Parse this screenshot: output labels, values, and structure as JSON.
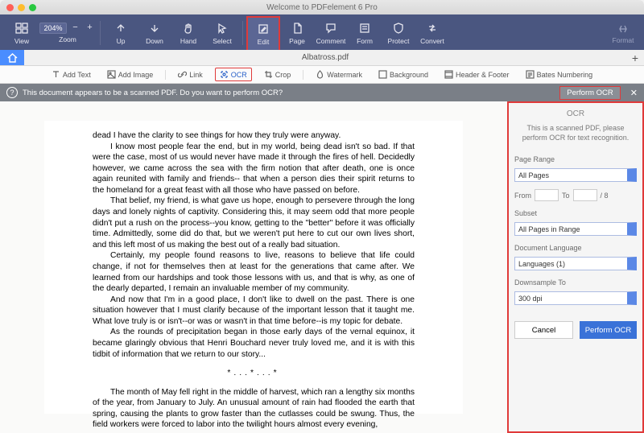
{
  "window": {
    "title": "Welcome to PDFelement 6 Pro"
  },
  "ribbon": {
    "view": "View",
    "zoom": "Zoom",
    "zoom_value": "204%",
    "up": "Up",
    "down": "Down",
    "hand": "Hand",
    "select": "Select",
    "edit": "Edit",
    "page": "Page",
    "comment": "Comment",
    "form": "Form",
    "protect": "Protect",
    "convert": "Convert",
    "format": "Format"
  },
  "tab": {
    "filename": "Albatross.pdf"
  },
  "toolbar2": {
    "add_text": "Add Text",
    "add_image": "Add Image",
    "link": "Link",
    "ocr": "OCR",
    "crop": "Crop",
    "watermark": "Watermark",
    "background": "Background",
    "header_footer": "Header & Footer",
    "bates": "Bates Numbering"
  },
  "notice": {
    "text": "This document appears to be a scanned PDF. Do you want to perform OCR?",
    "button": "Perform OCR"
  },
  "document": {
    "p1": "dead I have the clarity to see things for how they truly were anyway.",
    "p2": "I know most people fear the end, but in my world, being dead isn't so bad. If that were the case, most of us would never have made it through the fires of hell. Decidedly however, we came across the sea with the firm notion that after death, one is once again reunited with family and friends-- that when a person dies their spirit returns to the homeland for a great feast with all those who have passed on before.",
    "p3": "That belief, my friend, is what gave us hope, enough to persevere through the long days and lonely nights of captivity. Considering this, it may seem odd that more people didn't put a rush on the process--you know, getting to the \"better\" before it was officially time. Admittedly, some did do that, but we weren't put here to cut our own lives short, and this left most of us making the best out of a really bad situation.",
    "p4": "Certainly, my people found reasons to live, reasons to believe that life could change, if not for themselves then at least for the generations that came after. We learned from our hardships and took those lessons with us, and that is why, as one of the dearly departed, I remain an invaluable member of my community.",
    "p5": "And now that I'm in a good place, I don't like to dwell on the past. There is one situation however that I must clarify because of the important lesson that it taught me. What love truly is or isn't--or was or wasn't in that time before--is my topic for debate.",
    "p6": "As the rounds of precipitation began in those early days of the vernal equinox, it became glaringly obvious that Henri Bouchard never truly loved me, and it is with this tidbit of information that we return to our story...",
    "stars": "*...*...*",
    "p7": "The month of May fell right in the middle of harvest, which ran a lengthy six months of the year, from January to July. An unusual amount of rain had flooded the earth that spring, causing the plants to grow faster than the cutlasses could be swung. Thus, the field workers were forced to labor into the twilight hours almost every evening,"
  },
  "ocr_panel": {
    "title": "OCR",
    "hint": "This is a scanned PDF, please perform OCR for text recognition.",
    "page_range_label": "Page Range",
    "page_range_value": "All Pages",
    "from_label": "From",
    "to_label": "To",
    "total_suffix": "/ 8",
    "subset_label": "Subset",
    "subset_value": "All Pages in Range",
    "doc_lang_label": "Document Language",
    "doc_lang_value": "Languages (1)",
    "downsample_label": "Downsample To",
    "downsample_value": "300 dpi",
    "cancel": "Cancel",
    "perform": "Perform OCR"
  }
}
